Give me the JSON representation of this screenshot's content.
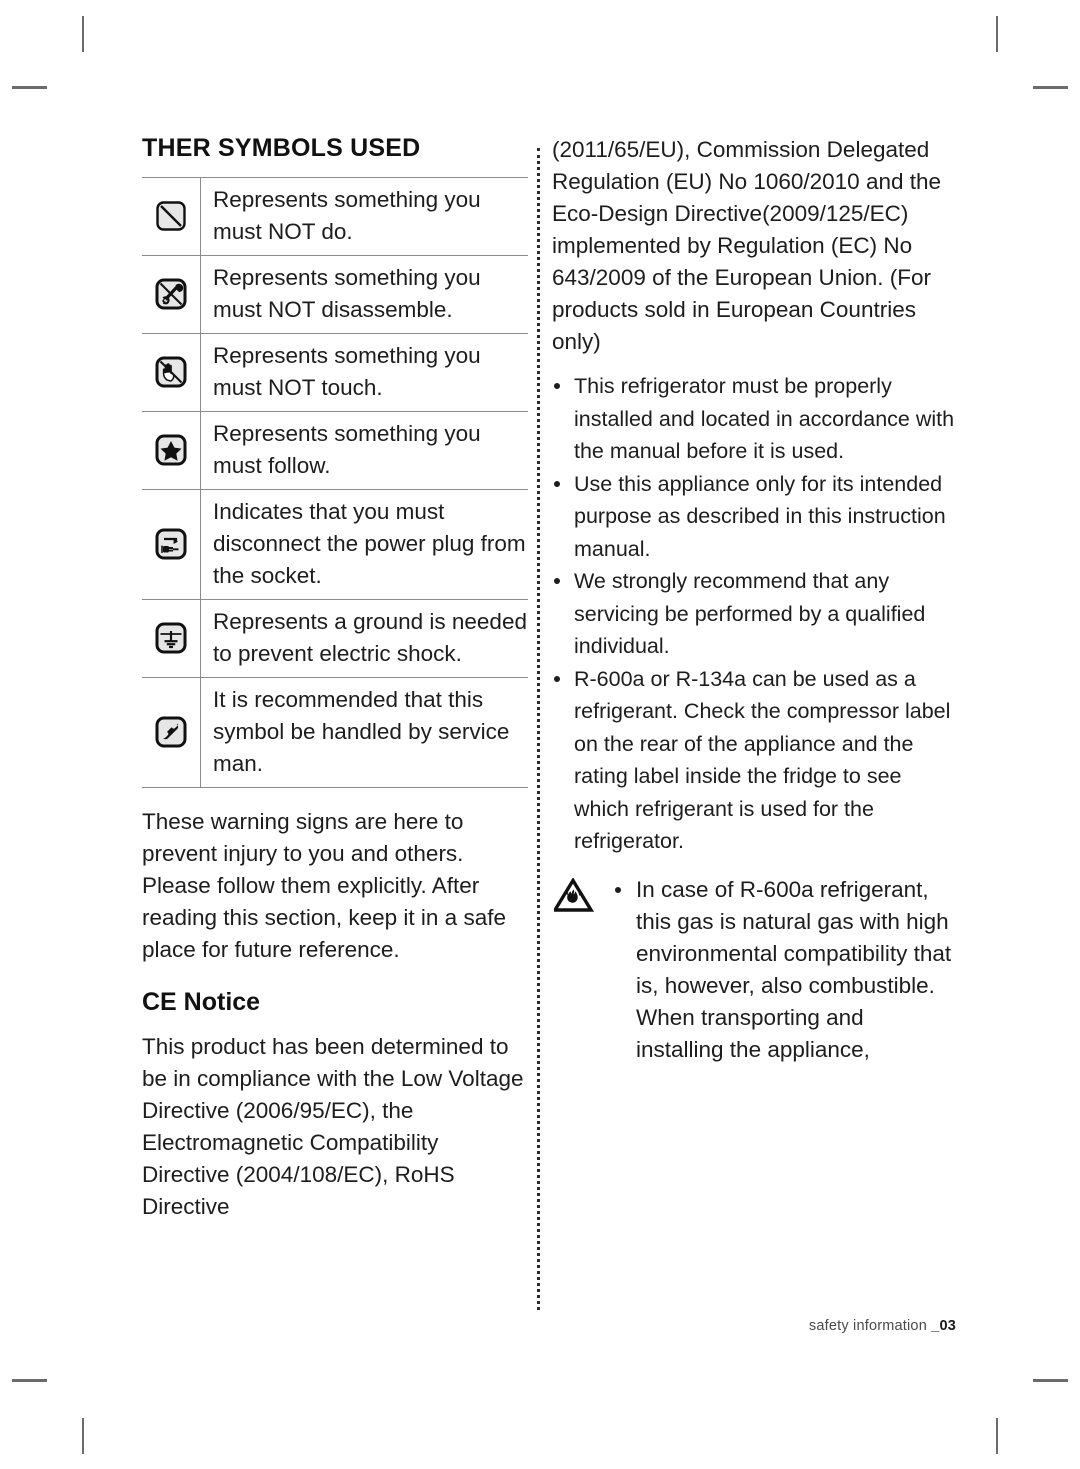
{
  "document": {
    "footer_text": "safety information ",
    "footer_page": "_03"
  },
  "left_column": {
    "section_title": "THER SYMBOLS USED",
    "symbol_table": {
      "rows": [
        {
          "icon": "no-do-slash-icon",
          "text": "Represents something you must NOT do."
        },
        {
          "icon": "no-disassemble-tools-icon",
          "text": "Represents something you must NOT disassemble."
        },
        {
          "icon": "no-touch-hand-icon",
          "text": "Represents something you must NOT touch."
        },
        {
          "icon": "must-follow-star-icon",
          "text": "Represents something you must follow."
        },
        {
          "icon": "disconnect-power-plug-icon",
          "text": "Indicates that you must disconnect the power plug from the socket."
        },
        {
          "icon": "ground-earth-icon",
          "text": "Represents a ground is needed to prevent electric shock."
        },
        {
          "icon": "service-telephone-icon",
          "text": "It is recommended that this symbol be handled by service man."
        }
      ]
    },
    "warning_note": "These warning signs are here to prevent injury to you and others. Please follow them explicitly. After reading this section, keep it in a safe place for future reference.",
    "ce_notice": {
      "heading": "CE Notice",
      "paragraph": "This product has been determined to be in compliance with the Low Voltage Directive (2006/95/EC), the Electromagnetic Compatibility Directive (2004/108/EC), RoHS Directive"
    }
  },
  "right_column": {
    "continued_paragraph": "(2011/65/EU), Commission Delegated Regulation (EU) No 1060/2010 and the Eco-Design Directive(2009/125/EC) implemented by Regulation (EC) No 643/2009 of the European Union. (For products sold in European Countries only)",
    "bullets": [
      "This refrigerator must be properly installed and located in accordance with the manual before it is used.",
      "Use this appliance only for its intended purpose as described in this instruction manual.",
      "We strongly recommend that any servicing be performed by a qualified individual.",
      "R-600a or R-134a can be used as a refrigerant. Check the compressor label on the rear of the appliance and the rating label inside the fridge to see which refrigerant is used for the refrigerator."
    ],
    "warning_block": {
      "icon": "flammable-warning-triangle-icon",
      "bullets": [
        "In case of R-600a refrigerant, this gas is natural gas with high environmental compatibility that is, however, also combustible. When transporting and installing the appliance,"
      ]
    }
  },
  "colors": {
    "text": "#1d1d1d",
    "rule": "#8c8c8c",
    "crop_mark": "#6b6b6b",
    "divider": "#2b2b2b"
  }
}
